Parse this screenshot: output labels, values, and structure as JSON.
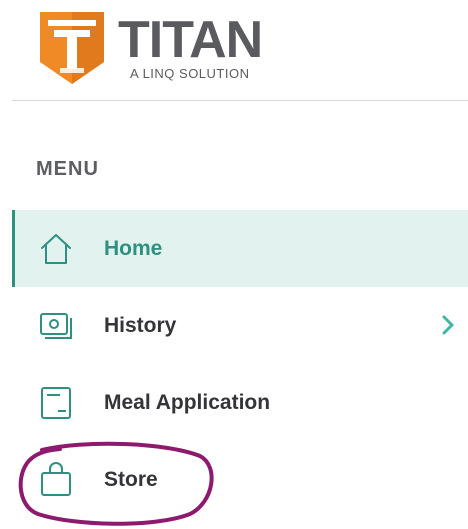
{
  "brand": {
    "name": "TITAN",
    "tagline": "A LINQ SOLUTION",
    "shield_letter": "T",
    "colors": {
      "shield_orange": "#f08a24",
      "shield_dark": "#d2691e",
      "text_gray": "#5a5b5e"
    }
  },
  "menu": {
    "heading": "MENU",
    "items": [
      {
        "label": "Home",
        "icon": "home-icon",
        "active": true
      },
      {
        "label": "History",
        "icon": "receipt-icon",
        "active": false,
        "has_children": true
      },
      {
        "label": "Meal Application",
        "icon": "form-icon",
        "active": false
      },
      {
        "label": "Store",
        "icon": "shopping-bag-icon",
        "active": false
      }
    ]
  },
  "colors": {
    "accent": "#2f8f80",
    "active_bg": "#e2f2ef",
    "annotation": "#8e1a6e"
  }
}
